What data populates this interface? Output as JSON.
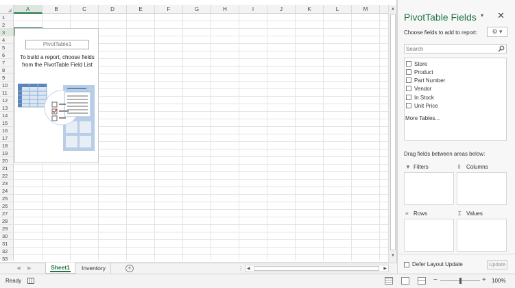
{
  "sheet": {
    "columns": [
      "A",
      "B",
      "C",
      "D",
      "E",
      "F",
      "G",
      "H",
      "I",
      "J",
      "K",
      "L",
      "M"
    ],
    "active_column": "A",
    "rows": [
      "1",
      "2",
      "3",
      "4",
      "5",
      "6",
      "7",
      "8",
      "9",
      "10",
      "11",
      "12",
      "13",
      "14",
      "15",
      "16",
      "17",
      "18",
      "19",
      "20",
      "21",
      "22",
      "23",
      "24",
      "25",
      "26",
      "27",
      "28",
      "29",
      "30",
      "31",
      "32",
      "33"
    ],
    "active_row": "3"
  },
  "pivot_placeholder": {
    "name": "PivotTable1",
    "help_text": "To build a report, choose fields from the PivotTable Field List"
  },
  "tabs": {
    "sheets": [
      "Sheet1",
      "Inventory"
    ],
    "active": "Sheet1",
    "add_label": "+",
    "dots": "⋮"
  },
  "pane": {
    "title": "PivotTable Fields",
    "dropdown_glyph": "▾",
    "close_glyph": "✕",
    "choose_label": "Choose fields to add to report:",
    "tools_glyph": "⚙ ▾",
    "search_placeholder": "Search",
    "fields": [
      "Store",
      "Product",
      "Part Number",
      "Vendor",
      "In Stock",
      "Unit Price"
    ],
    "more_tables": "More Tables...",
    "drag_label": "Drag fields between areas below:",
    "areas": {
      "filters": "Filters",
      "columns": "Columns",
      "rows": "Rows",
      "values": "Values"
    },
    "defer_label": "Defer Layout Update",
    "update_label": "Update"
  },
  "status": {
    "ready": "Ready",
    "zoom": "100%",
    "zoom_fraction": 0.5
  },
  "icons": {
    "pane_tools": "gear-icon",
    "search": "search-icon",
    "filters": "filter-icon",
    "columns": "columns-icon",
    "rows": "rows-icon",
    "values": "sigma-icon"
  },
  "colors": {
    "accent": "#217346"
  }
}
